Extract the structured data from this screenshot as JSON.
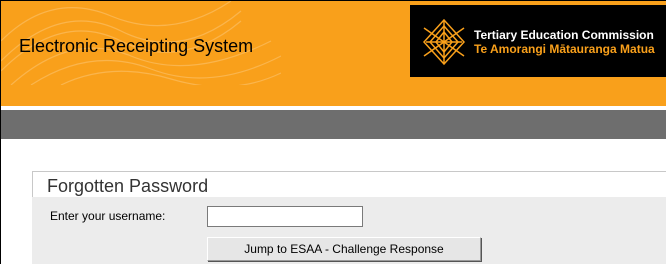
{
  "header": {
    "app_title": "Electronic Receipting System",
    "brand_line1": "Tertiary Education Commission",
    "brand_line2": "Te Amorangi Mātauranga Matua",
    "logo_icon": "tec-diamond-logo-icon"
  },
  "colors": {
    "header_orange": "#f9a01b",
    "nav_grey": "#6e6e6e",
    "panel_grey": "#ececec"
  },
  "forgot_password": {
    "title": "Forgotten Password",
    "username_label": "Enter your username:",
    "username_value": "",
    "submit_label": "Jump to ESAA - Challenge Response"
  }
}
